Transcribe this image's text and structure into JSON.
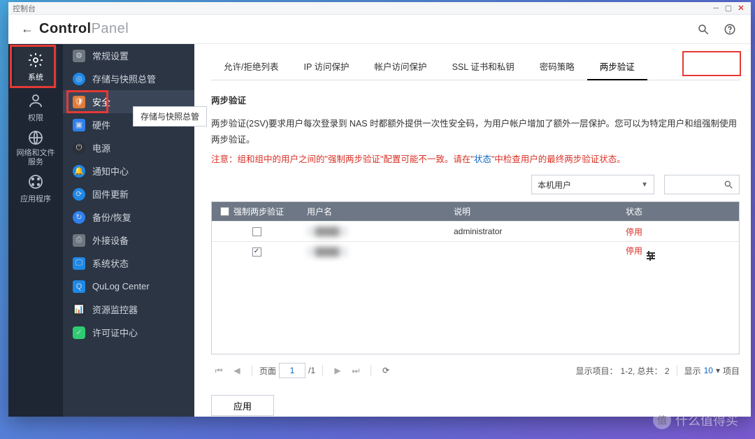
{
  "window": {
    "title": "控制台"
  },
  "app": {
    "title_bold": "Control",
    "title_light": "Panel"
  },
  "rail": {
    "items": [
      {
        "label": "系统",
        "icon": "gear"
      },
      {
        "label": "权限",
        "icon": "user"
      },
      {
        "label": "网络和文件服务",
        "icon": "globe"
      },
      {
        "label": "应用程序",
        "icon": "grid"
      }
    ]
  },
  "sidebar": {
    "tooltip": "存储与快照总管",
    "items": [
      {
        "label": "常规设置",
        "icon": "gear"
      },
      {
        "label": "存储与快照总管",
        "icon": "storage"
      },
      {
        "label": "安全",
        "icon": "shield"
      },
      {
        "label": "硬件",
        "icon": "hw"
      },
      {
        "label": "电源",
        "icon": "power"
      },
      {
        "label": "通知中心",
        "icon": "notif"
      },
      {
        "label": "固件更新",
        "icon": "fw"
      },
      {
        "label": "备份/恢复",
        "icon": "backup"
      },
      {
        "label": "外接设备",
        "icon": "ext"
      },
      {
        "label": "系统状态",
        "icon": "status"
      },
      {
        "label": "QuLog Center",
        "icon": "qulog"
      },
      {
        "label": "资源监控器",
        "icon": "res"
      },
      {
        "label": "许可证中心",
        "icon": "lic"
      }
    ]
  },
  "tabs": {
    "items": [
      {
        "label": "允许/拒绝列表"
      },
      {
        "label": "IP 访问保护"
      },
      {
        "label": "帐户访问保护"
      },
      {
        "label": "SSL 证书和私钥"
      },
      {
        "label": "密码策略"
      },
      {
        "label": "两步验证"
      }
    ]
  },
  "section": {
    "title": "两步验证",
    "desc": "两步验证(2SV)要求用户每次登录到 NAS 时都额外提供一次性安全码，为用户帐户增加了额外一层保护。您可以为特定用户和组强制使用两步验证。",
    "note_prefix": "注意：组和组中的用户之间的\"强制两步验证\"配置可能不一致。请在\"",
    "note_link": "状态",
    "note_suffix": "\"中检查用户的最终两步验证状态。"
  },
  "filters": {
    "scope": "本机用户"
  },
  "table": {
    "headers": {
      "force": "强制两步验证",
      "user": "用户名",
      "desc": "说明",
      "status": "状态"
    },
    "rows": [
      {
        "forced": false,
        "user": "████",
        "desc": "administrator",
        "status": "停用",
        "tunable": false
      },
      {
        "forced": true,
        "user": "████",
        "desc": "",
        "status": "停用",
        "tunable": true
      }
    ]
  },
  "pager": {
    "page_label": "页面",
    "page": "1",
    "total_pages": "/1",
    "summary_prefix": "显示项目：",
    "summary_range": "1-2, 总共： 2",
    "show_label": "显示",
    "page_size": "10",
    "items_suffix": "项目"
  },
  "buttons": {
    "apply": "应用"
  },
  "watermark": "什么值得买"
}
